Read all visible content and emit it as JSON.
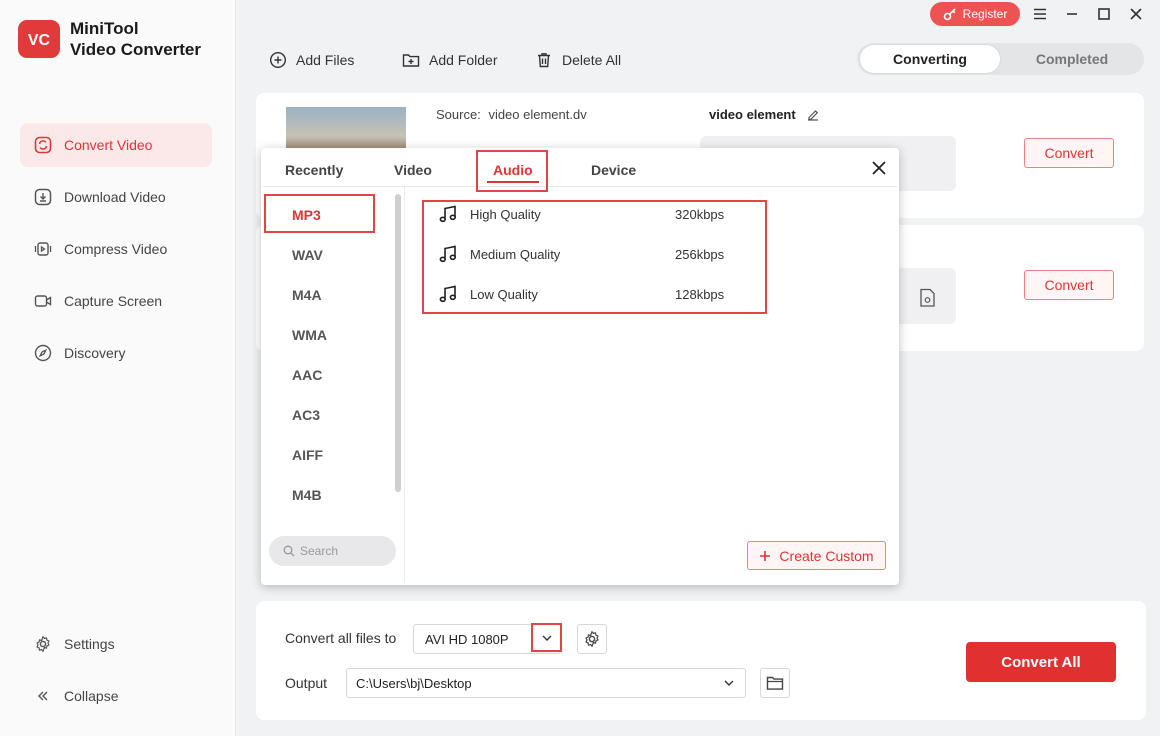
{
  "app": {
    "name_line1": "MiniTool",
    "name_line2": "Video Converter",
    "logo_text": "VC",
    "accent_color": "#e03434"
  },
  "sidebar": {
    "items": [
      {
        "label": "Convert Video",
        "icon": "convert-icon",
        "active": true
      },
      {
        "label": "Download Video",
        "icon": "download-icon"
      },
      {
        "label": "Compress Video",
        "icon": "compress-icon"
      },
      {
        "label": "Capture Screen",
        "icon": "camera-icon"
      },
      {
        "label": "Discovery",
        "icon": "compass-icon"
      }
    ],
    "settings_label": "Settings",
    "collapse_label": "Collapse"
  },
  "topbar": {
    "register_label": "Register"
  },
  "toolbar": {
    "add_files": "Add Files",
    "add_folder": "Add Folder",
    "delete_all": "Delete All"
  },
  "tabs": {
    "converting": "Converting",
    "completed": "Completed"
  },
  "files": [
    {
      "source_label": "Source:",
      "source_name": "video element.dv",
      "target_name": "video element",
      "convert_label": "Convert"
    },
    {
      "convert_label": "Convert"
    }
  ],
  "format_popup": {
    "tabs": [
      "Recently",
      "Video",
      "Audio",
      "Device"
    ],
    "active_tab": "Audio",
    "formats": [
      "MP3",
      "WAV",
      "M4A",
      "WMA",
      "AAC",
      "AC3",
      "AIFF",
      "M4B"
    ],
    "selected_format": "MP3",
    "qualities": [
      {
        "name": "High Quality",
        "bitrate": "320kbps"
      },
      {
        "name": "Medium Quality",
        "bitrate": "256kbps"
      },
      {
        "name": "Low Quality",
        "bitrate": "128kbps"
      }
    ],
    "search_placeholder": "Search",
    "create_custom_label": "Create Custom"
  },
  "bottom": {
    "convert_all_files_label": "Convert all files to",
    "target_format": "AVI HD 1080P",
    "output_label": "Output",
    "output_path": "C:\\Users\\bj\\Desktop",
    "convert_all_label": "Convert All"
  }
}
